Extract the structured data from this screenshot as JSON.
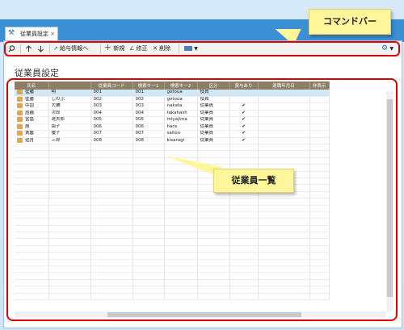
{
  "tab": {
    "title": "従業員設定"
  },
  "callouts": {
    "command_bar": "コマンドバー",
    "employee_list": "従業員一覧"
  },
  "toolbar": {
    "search_icon": "search-icon",
    "up_icon": "arrow-up-icon",
    "down_icon": "arrow-down-icon",
    "salary_info": "給与情報へ",
    "new": "新規",
    "edit": "修正",
    "delete": "削除",
    "view_icon": "view-icon",
    "settings_icon": "gear-icon"
  },
  "page": {
    "title": "従業員設定"
  },
  "table": {
    "headers": [
      "氏名",
      "",
      "従業員コード",
      "検索キー1",
      "検索キー2",
      "区分",
      "賞与あり",
      "退職年月日",
      "非表示"
    ],
    "rows": [
      [
        "徒勝",
        "明",
        "001",
        "001",
        "gotoua",
        "役員",
        "",
        "",
        ""
      ],
      [
        "徒勝",
        "しのぶ",
        "002",
        "002",
        "gotoua",
        "役員",
        "",
        "",
        ""
      ],
      [
        "中田",
        "大輔",
        "003",
        "003",
        "nakata",
        "従業員",
        "✔",
        "",
        ""
      ],
      [
        "高橋",
        "次郎",
        "004",
        "004",
        "takahash",
        "従業員",
        "✔",
        "",
        ""
      ],
      [
        "宮島",
        "達夫郎",
        "005",
        "005",
        "miyajima",
        "従業員",
        "✔",
        "",
        ""
      ],
      [
        "原",
        "由子",
        "006",
        "006",
        "hara",
        "従業員",
        "✔",
        "",
        ""
      ],
      [
        "斉藤",
        "優子",
        "007",
        "007",
        "saitou",
        "従業員",
        "✔",
        "",
        ""
      ],
      [
        "如月",
        "三郎",
        "008",
        "008",
        "kisaragi",
        "従業員",
        "✔",
        "",
        ""
      ]
    ]
  }
}
